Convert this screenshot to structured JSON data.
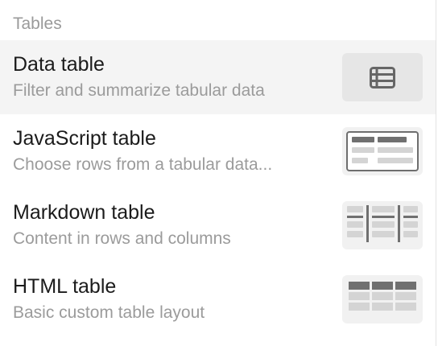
{
  "section": {
    "header": "Tables"
  },
  "items": [
    {
      "title": "Data table",
      "subtitle": "Filter and summarize tabular data",
      "icon": "data-table-icon",
      "selected": true
    },
    {
      "title": "JavaScript table",
      "subtitle": "Choose rows from a tabular data...",
      "icon": "javascript-table-thumbnail",
      "selected": false
    },
    {
      "title": "Markdown table",
      "subtitle": "Content in rows and columns",
      "icon": "markdown-table-thumbnail",
      "selected": false
    },
    {
      "title": "HTML table",
      "subtitle": "Basic custom table layout",
      "icon": "html-table-thumbnail",
      "selected": false
    }
  ],
  "colors": {
    "selected_background": "#f4f4f4",
    "thumbnail_background": "#f1f1f1",
    "title_text": "#1b1b1b",
    "secondary_text": "#9b9b9b",
    "thumbnail_dark": "#707070",
    "thumbnail_light": "#d4d4d4"
  }
}
